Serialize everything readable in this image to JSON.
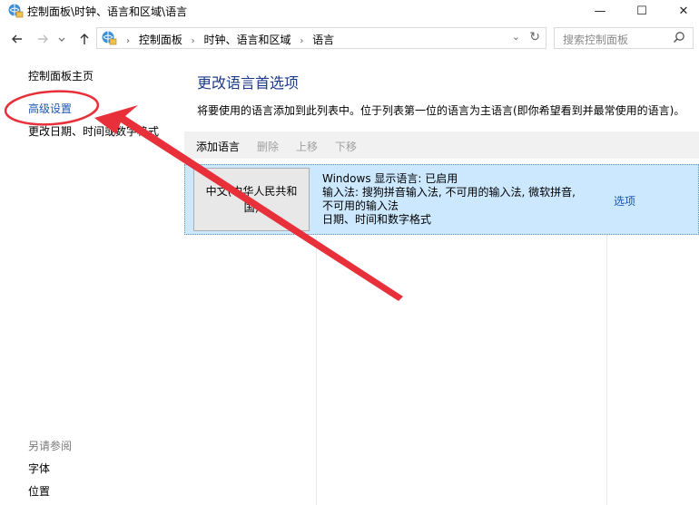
{
  "window": {
    "title": "控制面板\\时钟、语言和区域\\语言",
    "minimize": "—",
    "maximize": "☐",
    "close": "✕"
  },
  "nav": {
    "back_icon": "arrow-left-icon",
    "forward_icon": "arrow-right-icon",
    "recent_icon": "chevron-down-icon",
    "up_icon": "arrow-up-icon"
  },
  "address": {
    "crumbs": [
      "控制面板",
      "时钟、语言和区域",
      "语言"
    ],
    "separator": "›",
    "dropdown": "⌄",
    "refresh": "↻"
  },
  "search": {
    "placeholder": "搜索控制面板"
  },
  "sidebar": {
    "home": "控制面板主页",
    "advanced": "高级设置",
    "date_format": "更改日期、时间或数字格式",
    "see_also": "另请参阅",
    "fonts": "字体",
    "location": "位置"
  },
  "main": {
    "title": "更改语言首选项",
    "description": "将要使用的语言添加到此列表中。位于列表第一位的语言为主语言(即你希望看到并最常使用的语言)。",
    "toolbar": {
      "add": "添加语言",
      "remove": "删除",
      "up": "上移",
      "down": "下移"
    },
    "languages": [
      {
        "name": "中文(中华人民共和国)",
        "line1": "Windows 显示语言: 已启用",
        "line2": "输入法: 搜狗拼音输入法, 不可用的输入法, 微软拼音,",
        "line3": "不可用的输入法",
        "line4": "日期、时间和数字格式",
        "options": "选项"
      }
    ]
  },
  "colors": {
    "link": "#1a56b0",
    "title": "#1e3a8a",
    "selection": "#cce8ff",
    "annotation": "#e8303a"
  }
}
